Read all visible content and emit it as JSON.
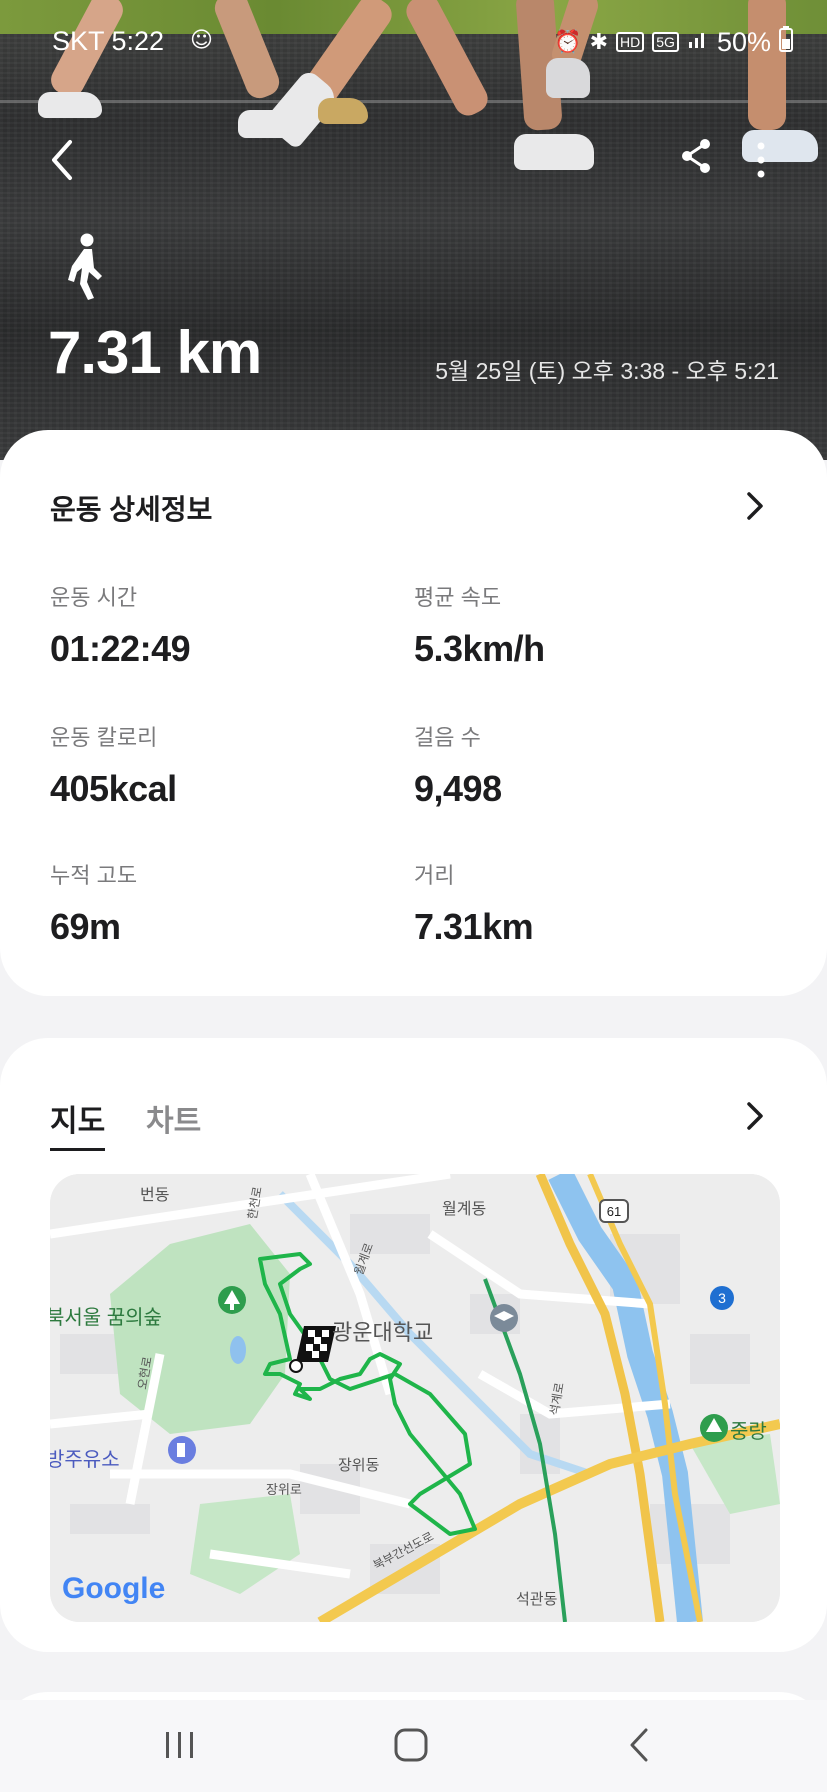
{
  "status_bar": {
    "carrier_time": "SKT 5:22",
    "battery": "50%",
    "icons": [
      "mascot-icon",
      "alarm-icon",
      "bluetooth-icon",
      "hd-icon",
      "5g-icon",
      "signal-icon",
      "battery-icon"
    ]
  },
  "hero": {
    "activity_icon": "walking-icon",
    "distance": "7.31 km",
    "date_range": "5월 25일 (토) 오후 3:38 - 오후 5:21"
  },
  "detail_card": {
    "title": "운동 상세정보",
    "stats": [
      {
        "label": "운동 시간",
        "value": "01:22:49"
      },
      {
        "label": "평균 속도",
        "value": "5.3km/h"
      },
      {
        "label": "운동 칼로리",
        "value": "405kcal"
      },
      {
        "label": "걸음 수",
        "value": "9,498"
      },
      {
        "label": "누적 고도",
        "value": "69m"
      },
      {
        "label": "거리",
        "value": "7.31km"
      }
    ]
  },
  "map_card": {
    "tabs": [
      "지도",
      "차트"
    ],
    "active_tab": "지도",
    "map_labels": {
      "beondong": "번동",
      "wolgyedong": "월계동",
      "forest": "북서울 꿈의숲",
      "university": "광운대학교",
      "gas": "방주유소",
      "jangwidong": "장위동",
      "jangwiro": "장위로",
      "seokgwandong": "석관동",
      "junglang": "중랑",
      "road_bukbu": "북부간선도로",
      "road_wolgye": "월계로",
      "road_hancheon": "한천로",
      "road_seokgye": "석계로",
      "road_odong": "오현로",
      "route_61": "61",
      "route_3": "3",
      "google": "Google"
    },
    "route_color": "#1fb54a"
  },
  "nav_bar": {
    "buttons": [
      "recents-icon",
      "home-icon",
      "back-icon"
    ]
  }
}
